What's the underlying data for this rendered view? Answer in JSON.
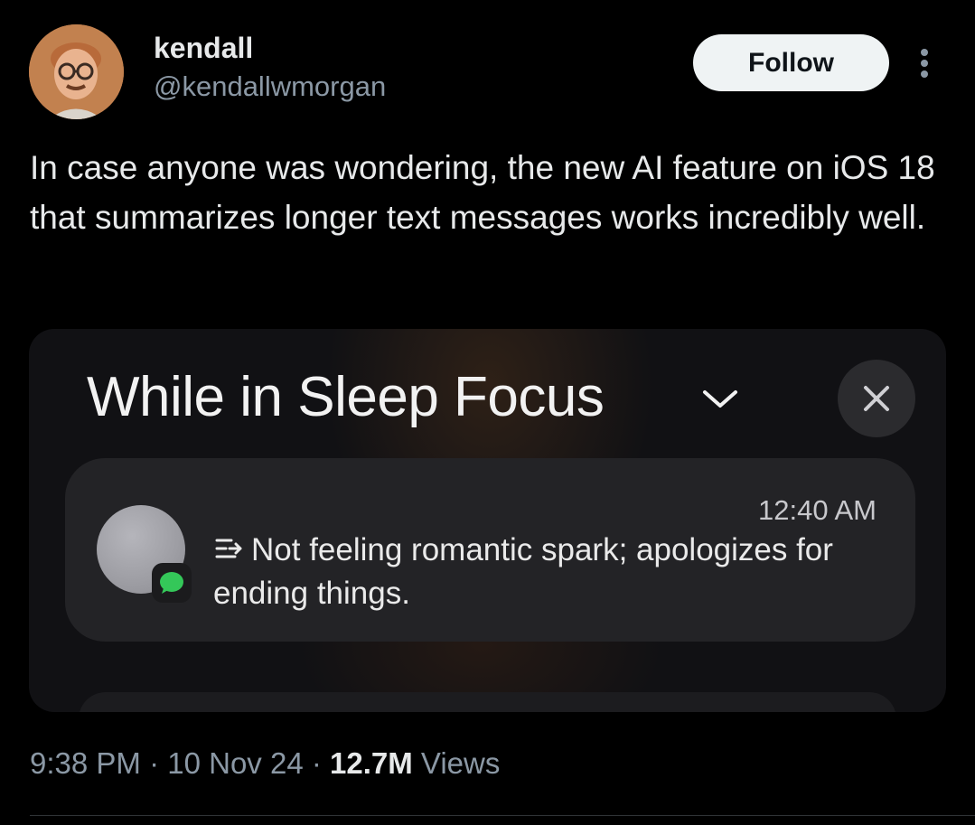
{
  "author": {
    "name": "kendall",
    "handle": "@kendallwmorgan"
  },
  "follow_label": "Follow",
  "tweet_text": "In case anyone was wondering, the new AI feature on iOS 18 that summarizes longer text messages works incredibly well.",
  "media": {
    "focus_title": "While in Sleep Focus",
    "notification": {
      "time": "12:40 AM",
      "summary": "Not feeling romantic spark; apologizes for ending things."
    }
  },
  "meta": {
    "time": "9:38 PM",
    "separator": "·",
    "date": "10 Nov 24",
    "views_count": "12.7M",
    "views_label": "Views"
  },
  "colors": {
    "background": "#000000",
    "text_primary": "#e7e9ea",
    "text_secondary": "#8b98a5",
    "follow_button_bg": "#eff3f4",
    "messages_green": "#34c759"
  },
  "icons": {
    "more": "more-vertical-icon",
    "chevron": "chevron-down-icon",
    "close": "close-icon",
    "summary": "summary-icon",
    "messages": "messages-app-icon"
  }
}
